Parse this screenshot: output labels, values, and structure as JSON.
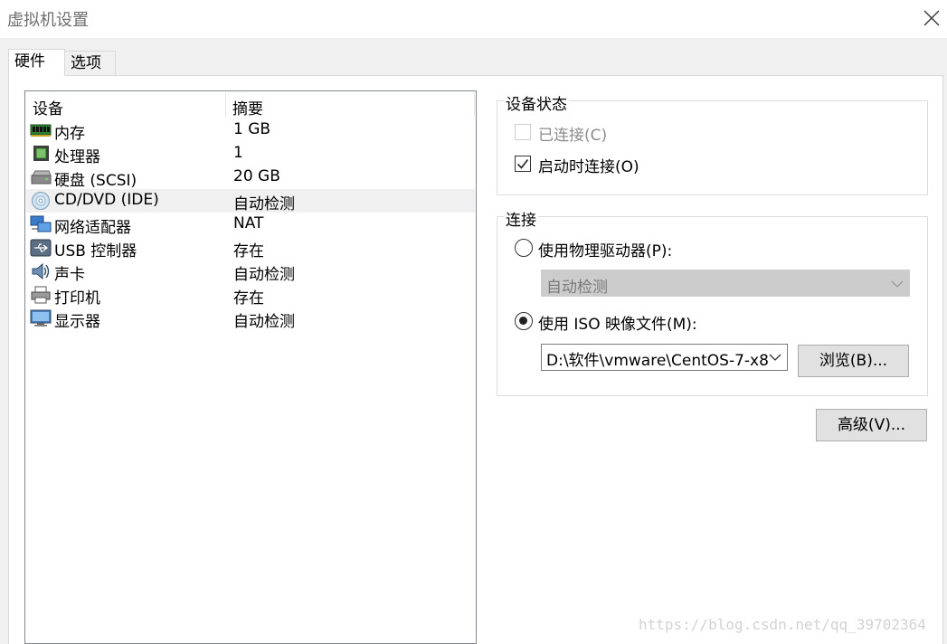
{
  "window": {
    "title": "虚拟机设置"
  },
  "tabs": [
    {
      "label": "硬件",
      "active": true
    },
    {
      "label": "选项",
      "active": false
    }
  ],
  "device_list": {
    "columns": [
      "设备",
      "摘要"
    ],
    "rows": [
      {
        "icon": "memory-icon",
        "name": "内存",
        "summary": "1 GB"
      },
      {
        "icon": "processor-icon",
        "name": "处理器",
        "summary": "1"
      },
      {
        "icon": "hard-disk-icon",
        "name": "硬盘 (SCSI)",
        "summary": "20 GB"
      },
      {
        "icon": "cd-dvd-icon",
        "name": "CD/DVD (IDE)",
        "summary": "自动检测",
        "selected": true
      },
      {
        "icon": "network-adapter-icon",
        "name": "网络适配器",
        "summary": "NAT"
      },
      {
        "icon": "usb-icon",
        "name": "USB 控制器",
        "summary": "存在"
      },
      {
        "icon": "sound-card-icon",
        "name": "声卡",
        "summary": "自动检测"
      },
      {
        "icon": "printer-icon",
        "name": "打印机",
        "summary": "存在"
      },
      {
        "icon": "display-icon",
        "name": "显示器",
        "summary": "自动检测"
      }
    ]
  },
  "device_status": {
    "label": "设备状态",
    "connected": {
      "label": "已连接(C)",
      "checked": false,
      "enabled": false
    },
    "connect_at_power_on": {
      "label": "启动时连接(O)",
      "checked": true
    }
  },
  "connection": {
    "label": "连接",
    "physical_drive": {
      "label": "使用物理驱动器(P):",
      "selected": false
    },
    "physical_drive_select": {
      "value": "自动检测",
      "enabled": false
    },
    "iso_image": {
      "label": "使用 ISO 映像文件(M):",
      "selected": true
    },
    "iso_path": {
      "value": "D:\\软件\\vmware\\CentOS-7-x8"
    },
    "browse_label": "浏览(B)..."
  },
  "advanced_label": "高级(V)...",
  "watermark": "https://blog.csdn.net/qq_39702364",
  "colors": {
    "selected_row": "#f0f0f0",
    "disabled_combo": "#cccccc",
    "button": "#e1e1e1"
  }
}
